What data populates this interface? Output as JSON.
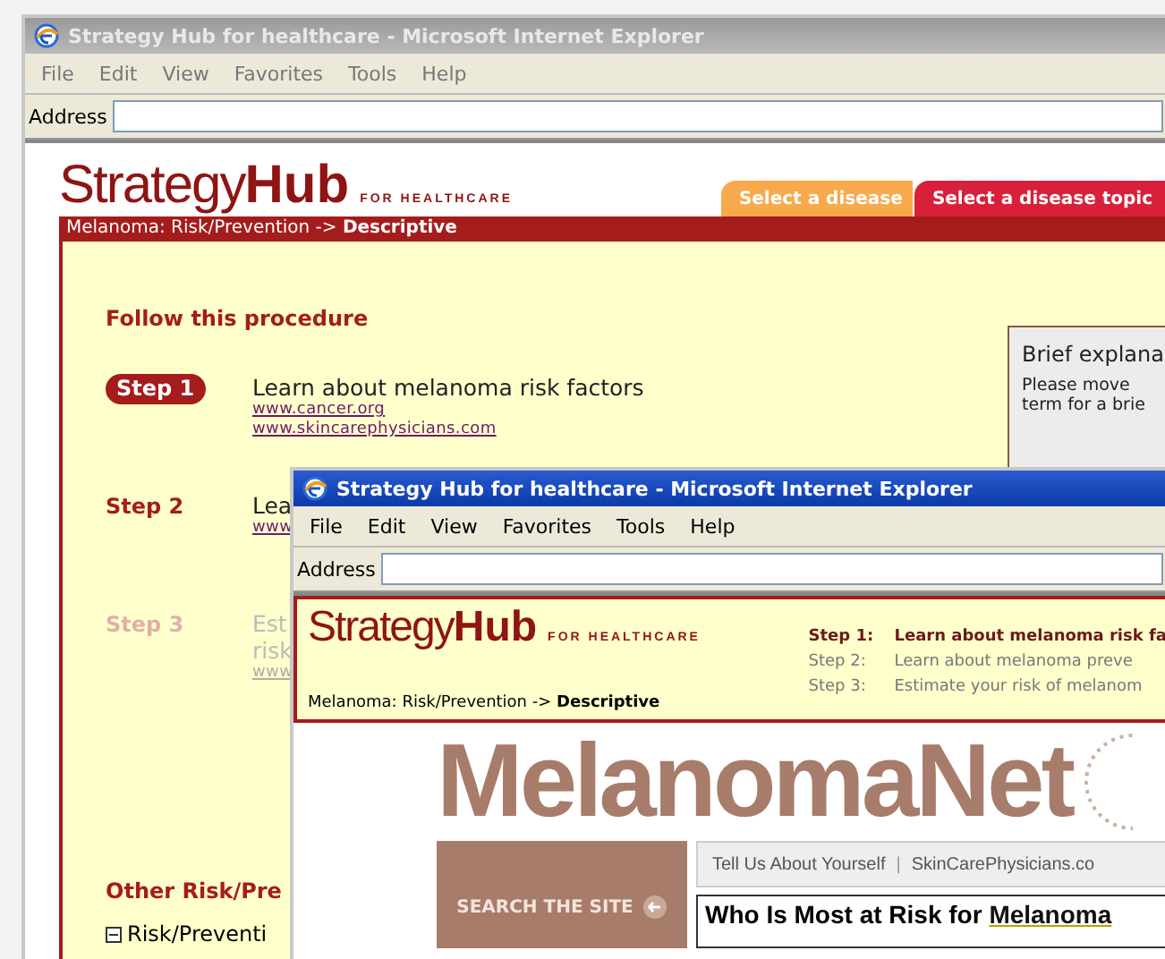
{
  "back_window": {
    "title": "Strategy Hub for healthcare - Microsoft Internet Explorer",
    "active": false,
    "menu": [
      "File",
      "Edit",
      "View",
      "Favorites",
      "Tools",
      "Help"
    ],
    "address_label": "Address",
    "logo": {
      "light": "Strategy",
      "bold": "Hub",
      "tagline": "FOR HEALTHCARE"
    },
    "tabs": [
      {
        "label": "Select a disease",
        "color": "#f7a94b"
      },
      {
        "label": "Select a disease topic",
        "color": "#d8203a"
      }
    ],
    "breadcrumb": {
      "path": "Melanoma: Risk/Prevention ->",
      "current": "Descriptive"
    },
    "procedure_heading": "Follow this procedure",
    "steps": [
      {
        "label": "Step 1",
        "current": true,
        "disabled": false,
        "lines": [
          "Learn about melanoma risk factors"
        ],
        "links": [
          "www.cancer.org",
          "www.skincarephysicians.com"
        ]
      },
      {
        "label": "Step 2",
        "current": false,
        "disabled": false,
        "lines": [
          "Lea"
        ],
        "links": [
          "www"
        ]
      },
      {
        "label": "Step 3",
        "current": false,
        "disabled": true,
        "lines": [
          "Est",
          "risk"
        ],
        "links": [
          "www"
        ]
      }
    ],
    "explanation": {
      "title": "Brief explana",
      "lines": [
        "Please move ",
        "term for a brie"
      ]
    },
    "other_heading": "Other Risk/Pre",
    "tree": [
      {
        "label": "Risk/Preventi",
        "expanded": true
      }
    ]
  },
  "front_window": {
    "title": "Strategy Hub for healthcare - Microsoft Internet Explorer",
    "active": true,
    "menu": [
      "File",
      "Edit",
      "View",
      "Favorites",
      "Tools",
      "Help"
    ],
    "address_label": "Address",
    "logo": {
      "light": "Strategy",
      "bold": "Hub",
      "tagline": "FOR HEALTHCARE"
    },
    "steps": [
      {
        "label": "Step 1:",
        "text": "Learn about melanoma risk fa",
        "current": true
      },
      {
        "label": "Step 2:",
        "text": "Learn about melanoma preve",
        "current": false
      },
      {
        "label": "Step 3:",
        "text": "Estimate your risk of melanom",
        "current": false
      }
    ],
    "breadcrumb": {
      "path": "Melanoma: Risk/Prevention ->",
      "current": "Descriptive"
    },
    "site": {
      "logo": "MelanomaNet",
      "search": "SEARCH THE SITE",
      "nav": [
        "Tell Us About Yourself",
        "SkinCarePhysicians.co"
      ],
      "nav_separator": "|",
      "heading": "Who Is Most at Risk for",
      "heading_link": "Melanoma"
    }
  }
}
